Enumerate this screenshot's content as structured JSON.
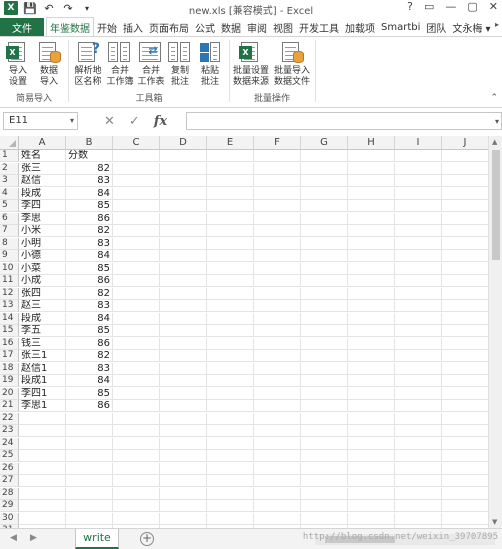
{
  "window": {
    "title": "new.xls  [兼容模式] - Excel",
    "controls": [
      "?",
      "▭",
      "—",
      "▢",
      "✕"
    ]
  },
  "ribbon_tabs": [
    {
      "label": "文件",
      "kind": "file"
    },
    {
      "label": "年鉴数据",
      "kind": "active"
    },
    {
      "label": "开始",
      "kind": "normal"
    },
    {
      "label": "插入",
      "kind": "normal"
    },
    {
      "label": "页面布局",
      "kind": "normal"
    },
    {
      "label": "公式",
      "kind": "normal"
    },
    {
      "label": "数据",
      "kind": "normal"
    },
    {
      "label": "审阅",
      "kind": "normal"
    },
    {
      "label": "视图",
      "kind": "normal"
    },
    {
      "label": "开发工具",
      "kind": "normal"
    },
    {
      "label": "加载项",
      "kind": "normal"
    },
    {
      "label": "Smartbi",
      "kind": "normal"
    },
    {
      "label": "团队",
      "kind": "normal"
    },
    {
      "label": "文永梅 ▾",
      "kind": "normal"
    }
  ],
  "ribbon_groups": {
    "simple_import": {
      "label": "简易导入",
      "buttons": [
        {
          "line1": "导入",
          "line2": "设置",
          "icon": "excel-settings-icon"
        },
        {
          "line1": "数据",
          "line2": "导入",
          "icon": "data-import-icon"
        }
      ]
    },
    "toolbox": {
      "label": "工具箱",
      "buttons": [
        {
          "line1": "解析地",
          "line2": "区名称",
          "icon": "parse-region-icon"
        },
        {
          "line1": "合并",
          "line2": "工作簿",
          "icon": "merge-workbook-icon"
        },
        {
          "line1": "合并",
          "line2": "工作表",
          "icon": "merge-sheet-icon"
        },
        {
          "line1": "复制",
          "line2": "批注",
          "icon": "copy-comment-icon"
        },
        {
          "line1": "粘贴",
          "line2": "批注",
          "icon": "paste-comment-icon"
        }
      ]
    },
    "batch": {
      "label": "批量操作",
      "buttons": [
        {
          "line1": "批量设置",
          "line2": "数据来源",
          "icon": "batch-source-icon"
        },
        {
          "line1": "批量导入",
          "line2": "数据文件",
          "icon": "batch-import-icon"
        }
      ]
    }
  },
  "formula_bar": {
    "name_box": "E11",
    "cancel_glyph": "✕",
    "enter_glyph": "✓",
    "fx_label": "fx",
    "formula": ""
  },
  "columns": [
    "A",
    "B",
    "C",
    "D",
    "E",
    "F",
    "G",
    "H",
    "I",
    "J"
  ],
  "rows": [
    [
      "姓名",
      "分数"
    ],
    [
      "张三",
      "82"
    ],
    [
      "赵信",
      "83"
    ],
    [
      "段成",
      "84"
    ],
    [
      "李四",
      "85"
    ],
    [
      "李思",
      "86"
    ],
    [
      "小米",
      "82"
    ],
    [
      "小明",
      "83"
    ],
    [
      "小德",
      "84"
    ],
    [
      "小菜",
      "85"
    ],
    [
      "小成",
      "86"
    ],
    [
      "张四",
      "82"
    ],
    [
      "赵三",
      "83"
    ],
    [
      "段成",
      "84"
    ],
    [
      "李五",
      "85"
    ],
    [
      "钱三",
      "86"
    ],
    [
      "张三1",
      "82"
    ],
    [
      "赵信1",
      "83"
    ],
    [
      "段成1",
      "84"
    ],
    [
      "李四1",
      "85"
    ],
    [
      "李思1",
      "86"
    ],
    [
      "",
      ""
    ],
    [
      "",
      ""
    ],
    [
      "",
      ""
    ],
    [
      "",
      ""
    ],
    [
      "",
      ""
    ],
    [
      "",
      ""
    ],
    [
      "",
      ""
    ],
    [
      "",
      ""
    ],
    [
      "",
      ""
    ],
    [
      "",
      ""
    ]
  ],
  "sheet_tabs": {
    "active": "write",
    "add_glyph": "+"
  },
  "watermark": "http://blog.csdn.net/weixin_39707895"
}
